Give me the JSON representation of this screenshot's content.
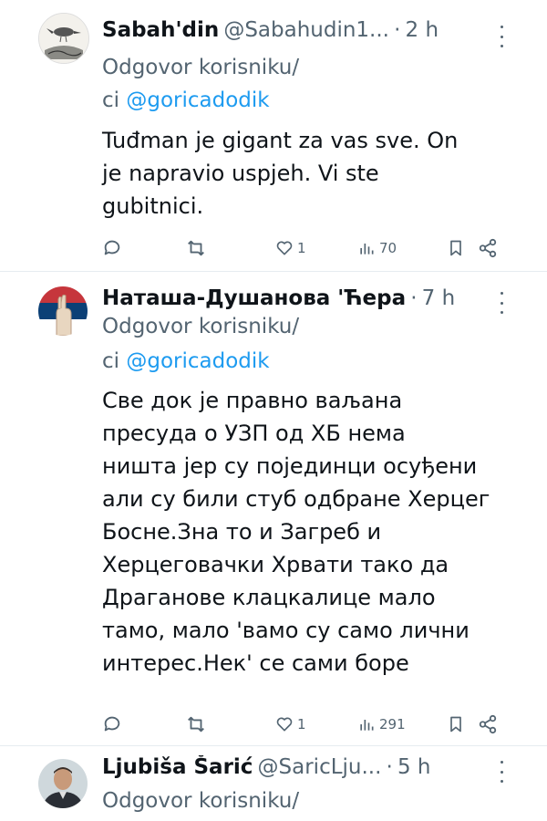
{
  "tweets": [
    {
      "name": "Sabah'din",
      "handle": "@Sabahudin1...",
      "time": "2 h",
      "reply_prefix": "Odgovor korisniku/",
      "reply_ci": "ci ",
      "reply_mention": "@goricadodik",
      "text": "Tuđman je gigant za vas sve. On\nje napravio uspjeh. Vi ste\ngubitnici.",
      "actions": {
        "replies": "",
        "reposts": "",
        "likes": "1",
        "views": "70"
      },
      "avatar_icon": "bird-sketch-avatar"
    },
    {
      "name": "Наташа-Душанова 'Ћера",
      "handle": "",
      "time": "7 h",
      "reply_prefix": "Odgovor korisniku/",
      "reply_ci": "ci ",
      "reply_mention": "@goricadodik",
      "text": "Све док је правно ваљана\nпресуда о УЗП од ХБ нема\nништа јер су појединци осуђени\nали су били стуб одбране Херцег\nБосне.Зна то и Загреб и\nХерцеговачки Хрвати тако да\nДрагановe клацкалице мало\nтамо, мало 'вамо су само лични\nинтерес.Нек' се сами боре",
      "actions": {
        "replies": "",
        "reposts": "",
        "likes": "1",
        "views": "291"
      },
      "avatar_icon": "serbian-flag-hand-avatar"
    },
    {
      "name": "Ljubiša Šarić",
      "handle": "@SaricLju...",
      "time": "5 h",
      "reply_prefix": "Odgovor korisniku/",
      "avatar_icon": "man-photo-avatar"
    }
  ],
  "colors": {
    "text": "#0f1419",
    "secondary": "#536471",
    "link": "#1d9bf0",
    "divider": "#e6ecf0"
  }
}
